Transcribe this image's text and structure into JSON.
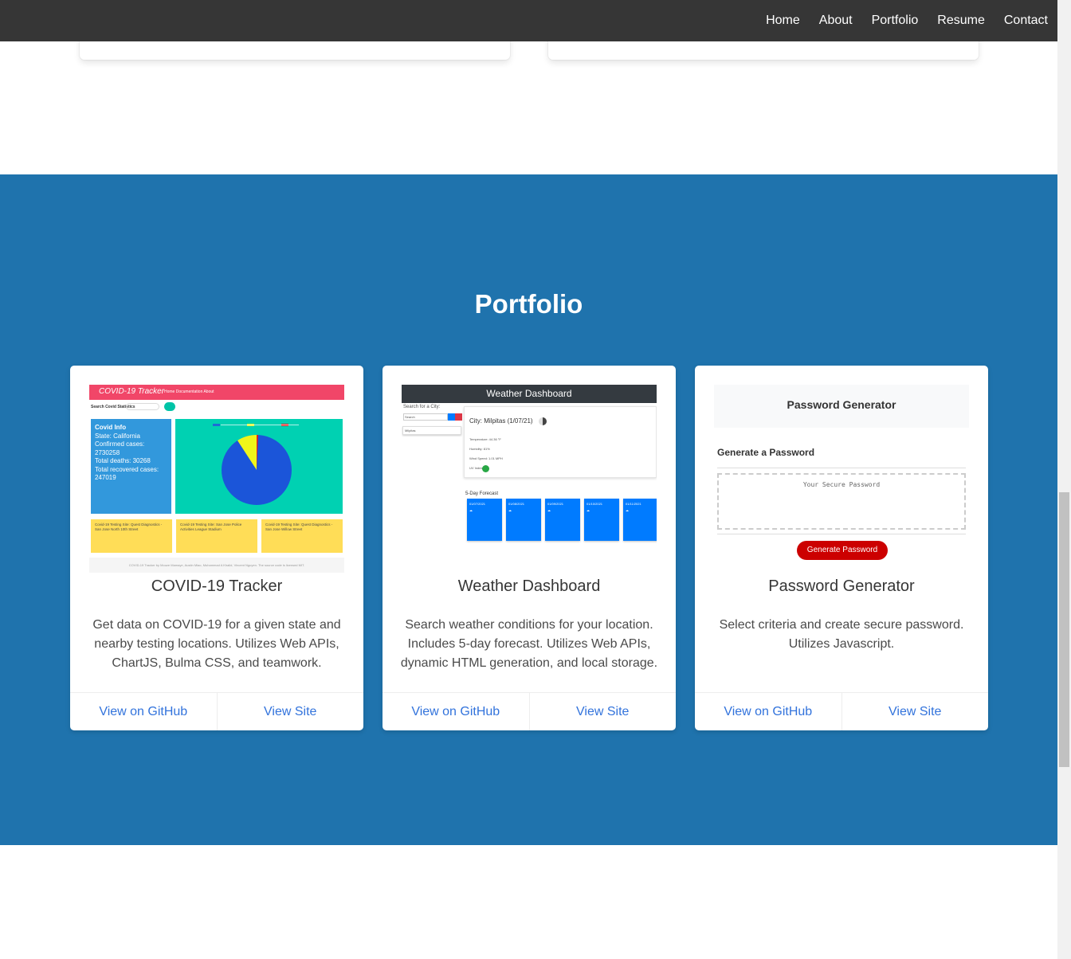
{
  "nav": {
    "links": [
      "Home",
      "About",
      "Portfolio",
      "Resume",
      "Contact"
    ]
  },
  "portfolio": {
    "title": "Portfolio",
    "projects": [
      {
        "title": "COVID-19 Tracker",
        "description": "Get data on COVID-19 for a given state and nearby testing locations. Utilizes Web APIs, ChartJS, Bulma CSS, and teamwork.",
        "github_label": "View on GitHub",
        "site_label": "View Site",
        "thumbnail": {
          "brand": "COVID-19 Tracker",
          "nav": "Home   Documentation   About",
          "search_label": "Search Covid Statistics",
          "info_title": "Covid Info",
          "info_lines": [
            "State: California",
            "Confirmed cases:",
            "2730258",
            "Total deaths: 30268",
            "Total recovered cases:",
            "247019"
          ],
          "testing_sites": [
            "Covid-19 Testing Site: Quest Diagnostics - San Jose North 10th Street",
            "Covid-19 Testing Site: San Jose Police Activities League Stadium",
            "Covid-19 Testing Site: Quest Diagnostics - San Jose Willow Street"
          ],
          "footer": "COVID-19 Tracker by Mouze Mamaye, Austin Miao, Muhammad A Khalid, Vincent Nguyen. The source code is licensed MIT."
        }
      },
      {
        "title": "Weather Dashboard",
        "description": "Search weather conditions for your location. Includes 5-day forecast. Utilizes Web APIs, dynamic HTML generation, and local storage.",
        "github_label": "View on GitHub",
        "site_label": "View Site",
        "thumbnail": {
          "header": "Weather Dashboard",
          "search_label": "Search for a City:",
          "search_placeholder": "Search",
          "history_item": "Milpitas",
          "city": "City: Milpitas (1/07/21)",
          "details": [
            "Temperature: 44.36 °F",
            "Humidity: 81%",
            "Wind Speed: 1.01 MPH",
            "UV Index:"
          ],
          "forecast_title": "5-Day Forecast",
          "forecast_dates": [
            "01/07/2021",
            "01/08/2021",
            "01/09/2021",
            "01/10/2021",
            "01/11/2021"
          ]
        }
      },
      {
        "title": "Password Generator",
        "description": "Select criteria and create secure password. Utilizes Javascript.",
        "github_label": "View on GitHub",
        "site_label": "View Site",
        "thumbnail": {
          "header": "Password Generator",
          "subheader": "Generate a Password",
          "placeholder": "Your Secure Password",
          "button": "Generate Password"
        }
      }
    ]
  },
  "colors": {
    "navbar": "#363636",
    "section_bg": "#1f73ad",
    "link": "#3273dc"
  }
}
